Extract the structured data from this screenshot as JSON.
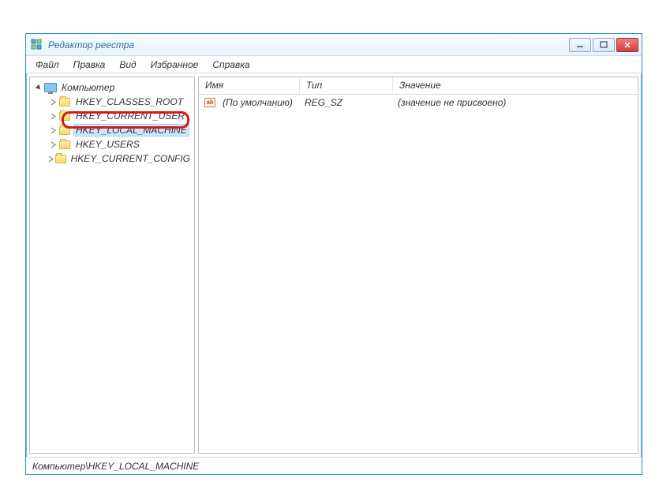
{
  "window": {
    "title": "Редактор реестра"
  },
  "menu": {
    "file": "Файл",
    "edit": "Правка",
    "view": "Вид",
    "favorites": "Избранное",
    "help": "Справка"
  },
  "tree": {
    "root": "Компьютер",
    "items": [
      "HKEY_CLASSES_ROOT",
      "HKEY_CURRENT_USER",
      "HKEY_LOCAL_MACHINE",
      "HKEY_USERS",
      "HKEY_CURRENT_CONFIG"
    ],
    "selected_index": 2
  },
  "columns": {
    "name": "Имя",
    "type": "Тип",
    "value": "Значение"
  },
  "values": [
    {
      "name": "(По умолчанию)",
      "type": "REG_SZ",
      "data": "(значение не присвоено)"
    }
  ],
  "statusbar": {
    "path": "Компьютер\\HKEY_LOCAL_MACHINE"
  }
}
